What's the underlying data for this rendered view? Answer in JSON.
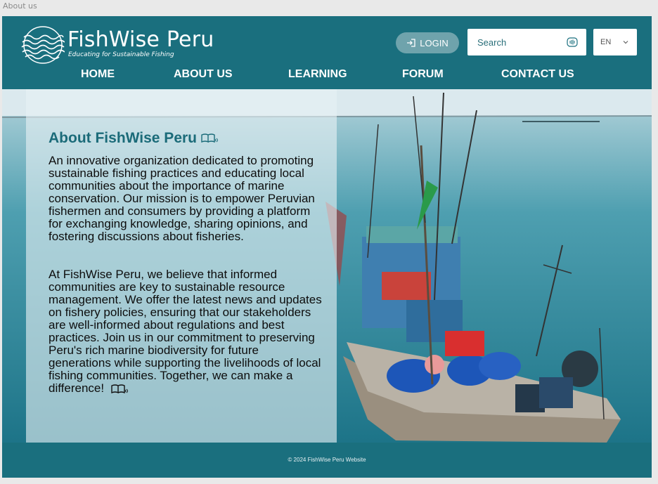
{
  "window": {
    "tab_label": "About us"
  },
  "header": {
    "logo_title": "FishWise Peru",
    "logo_subtitle": "Educating for Sustainable Fishing",
    "login_label": "LOGIN",
    "search_placeholder": "Search",
    "language": "EN"
  },
  "nav": {
    "items": [
      {
        "label": "HOME"
      },
      {
        "label": "ABOUT US"
      },
      {
        "label": "LEARNING"
      },
      {
        "label": "FORUM"
      },
      {
        "label": "CONTACT US"
      }
    ]
  },
  "about": {
    "title": "About FishWise Peru",
    "paragraph_1": "An innovative organization dedicated to promoting sustainable fishing practices and educating local communities about the importance of marine conservation. Our mission is to empower Peruvian fishermen and consumers by providing a platform for exchanging knowledge, sharing opinions, and fostering discussions about fisheries.",
    "paragraph_2": "At FishWise Peru, we believe that informed communities are key to sustainable resource management. We offer the latest news and updates on fishery policies, ensuring that our stakeholders are well-informed about regulations and best practices. Join us in our commitment to preserving Peru's rich marine biodiversity for future generations while supporting the livelihoods of local fishing communities. Together, we can make a difference!"
  },
  "footer": {
    "text": "© 2024 FishWise Peru Website"
  },
  "colors": {
    "brand": "#1a6f7e",
    "title": "#1b6b79",
    "login_bg": "#6fa3ac"
  },
  "icons": [
    "waves-logo-icon",
    "login-icon",
    "audio-search-icon",
    "chevron-down-icon",
    "read-aloud-icon"
  ]
}
